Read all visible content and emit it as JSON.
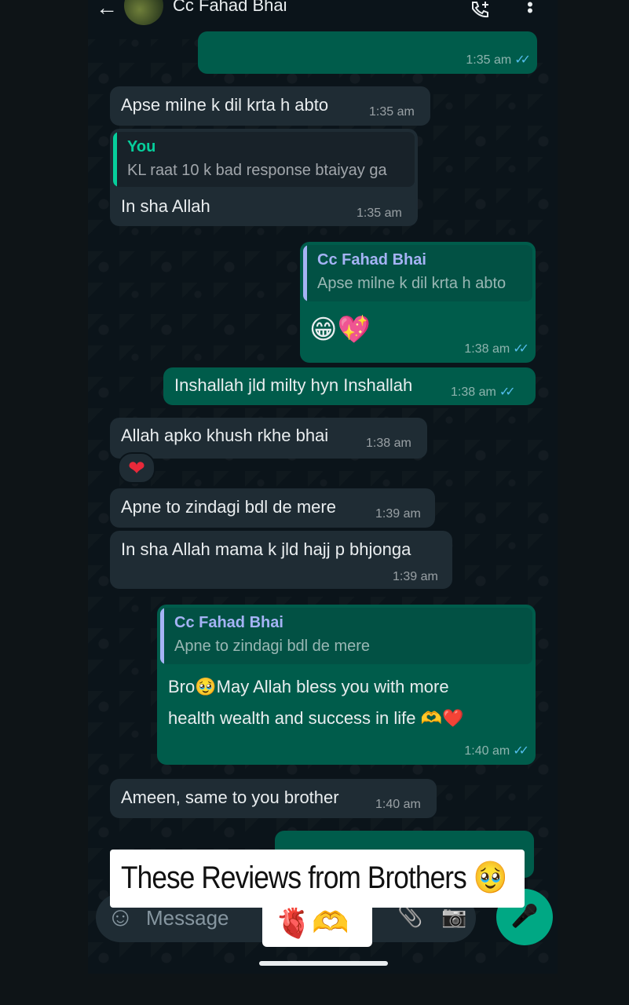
{
  "header": {
    "back_icon": "←",
    "contact_name": "Cc Fahad Bhai",
    "menu_icon": "⋮"
  },
  "messages": [
    {
      "id": "m0",
      "dir": "out",
      "text": "",
      "time": "1:35 am",
      "ticks": "✓✓"
    },
    {
      "id": "m1",
      "dir": "in",
      "text": "Apse milne k dil krta h abto",
      "time": "1:35 am"
    },
    {
      "id": "m2",
      "dir": "in",
      "quote_name": "You",
      "quote_text": "KL raat 10 k bad response btaiyay ga",
      "text": "In sha Allah",
      "time": "1:35 am"
    },
    {
      "id": "m3",
      "dir": "out",
      "quote_name": "Cc Fahad Bhai",
      "quote_text": "Apse milne k dil krta h abto",
      "text": "😁💖",
      "time": "1:38 am",
      "ticks": "✓✓"
    },
    {
      "id": "m4",
      "dir": "out",
      "text": "Inshallah jld milty hyn Inshallah",
      "time": "1:38 am",
      "ticks": "✓✓"
    },
    {
      "id": "m5",
      "dir": "in",
      "text": "Allah apko khush rkhe bhai",
      "time": "1:38 am",
      "reaction": "❤"
    },
    {
      "id": "m6",
      "dir": "in",
      "text": "Apne to zindagi bdl de mere",
      "time": "1:39 am"
    },
    {
      "id": "m7",
      "dir": "in",
      "text": "In sha Allah mama k jld hajj p bhjonga",
      "time": "1:39 am"
    },
    {
      "id": "m8",
      "dir": "out",
      "quote_name": "Cc Fahad Bhai",
      "quote_text": "Apne to zindagi bdl de mere",
      "text_line1_a": "Bro",
      "text_line1_emoji": "🥹",
      "text_line1_b": "May Allah bless you with more",
      "text_line2": "health wealth and success in life",
      "text_line2_emoji": "🫶❤️",
      "time": "1:40 am",
      "ticks": "✓✓"
    },
    {
      "id": "m9",
      "dir": "in",
      "text": "Ameen, same to you brother",
      "time": "1:40 am"
    }
  ],
  "input": {
    "placeholder": "Message",
    "emoji_icon": "☺",
    "attach_icon": "📎",
    "camera_icon": "📷",
    "mic_icon": "🎤"
  },
  "overlay": {
    "banner_text": "These Reviews from Brothers",
    "banner_emoji": "🥹",
    "sub_emojis": "🫀🫶"
  },
  "colors": {
    "incoming": "#1f2c34",
    "outgoing": "#005c4b",
    "ticks": "#53bdeb",
    "accent": "#00a884"
  }
}
